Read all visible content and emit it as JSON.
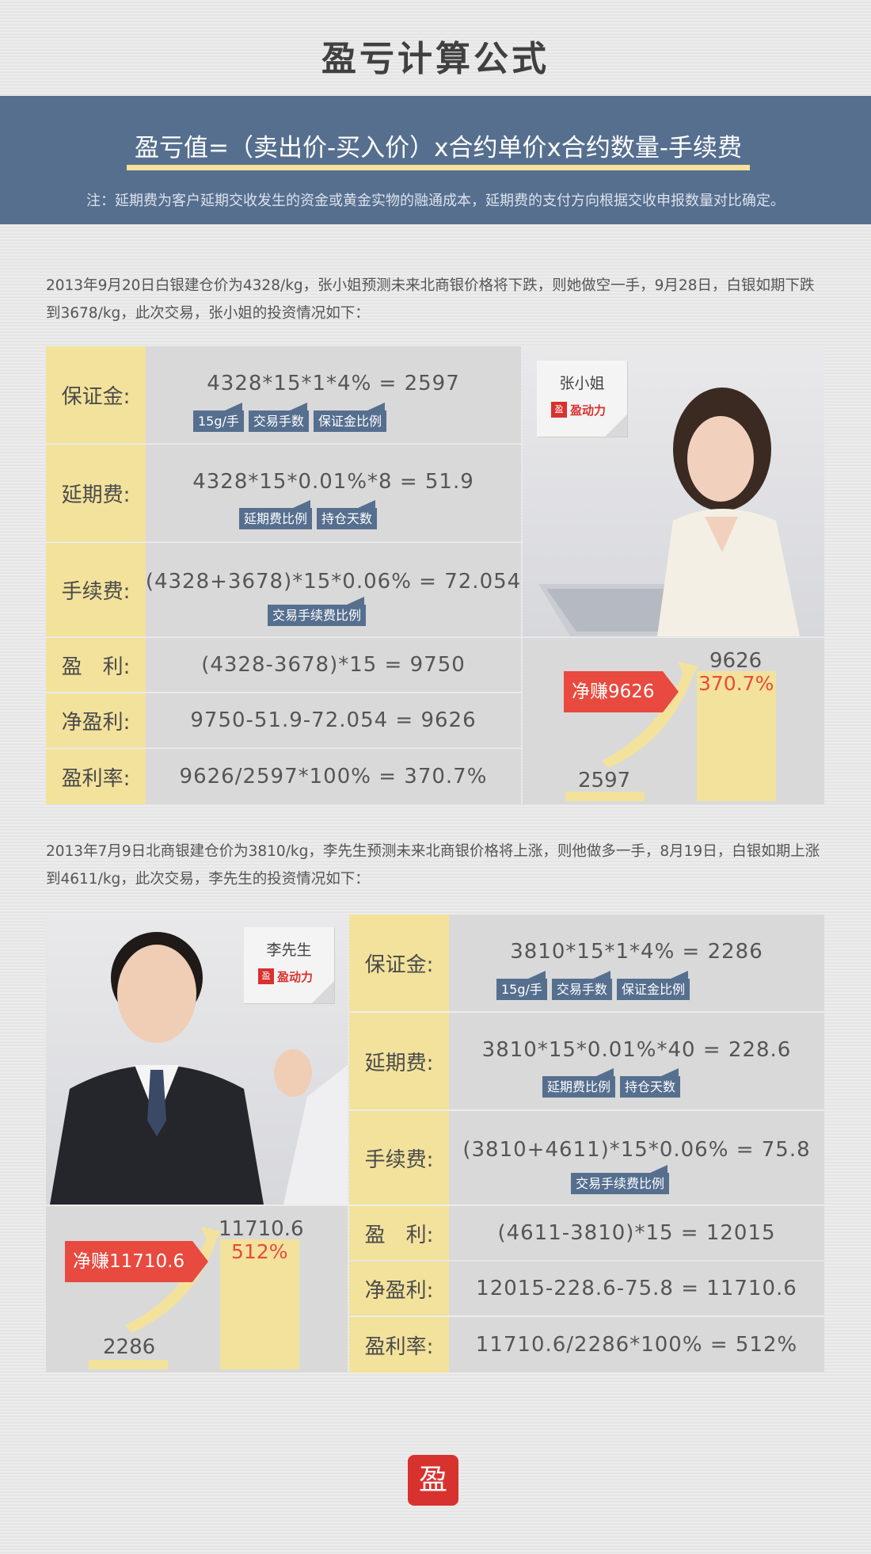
{
  "title": "盈亏计算公式",
  "banner": {
    "formula": "盈亏值=（卖出价-买入价）x合约单价x合约数量-手续费",
    "note": "注：延期费为客户延期交收发生的资金或黄金实物的融通成本，延期费的支付方向根据交收申报数量对比确定。"
  },
  "case1": {
    "intro": "2013年9月20日白银建仓价为4328/kg，张小姐预测未来北商银价格将下跌，则她做空一手，9月28日，白银如期下跌到3678/kg，此次交易，张小姐的投资情况如下：",
    "rows": [
      {
        "label": "保证金:",
        "value": "4328*15*1*4% = 2597",
        "tags": [
          "15g/手",
          "交易手数",
          "保证金比例"
        ]
      },
      {
        "label": "延期费:",
        "value": "4328*15*0.01%*8 = 51.9",
        "tags": [
          "延期费比例",
          "持仓天数"
        ]
      },
      {
        "label": "手续费:",
        "value": "(4328+3678)*15*0.06% = 72.054",
        "tags": [
          "交易手续费比例"
        ]
      },
      {
        "label": "盈　利:",
        "value": "(4328-3678)*15 = 9750"
      },
      {
        "label": "净盈利:",
        "value": "9750-51.9-72.054 = 9626"
      },
      {
        "label": "盈利率:",
        "value": "9626/2597*100% = 370.7%"
      }
    ],
    "person": "张小姐",
    "logo_text": "盈动力",
    "chart": {
      "base": "2597",
      "top": "9626",
      "pct": "370.7%",
      "badge": "净赚9626"
    }
  },
  "case2": {
    "intro": "2013年7月9日北商银建仓价为3810/kg，李先生预测未来北商银价格将上涨，则他做多一手，8月19日，白银如期上涨到4611/kg，此次交易，李先生的投资情况如下：",
    "rows": [
      {
        "label": "保证金:",
        "value": "3810*15*1*4% = 2286",
        "tags": [
          "15g/手",
          "交易手数",
          "保证金比例"
        ]
      },
      {
        "label": "延期费:",
        "value": "3810*15*0.01%*40 = 228.6",
        "tags": [
          "延期费比例",
          "持仓天数"
        ]
      },
      {
        "label": "手续费:",
        "value": "(3810+4611)*15*0.06% = 75.8",
        "tags": [
          "交易手续费比例"
        ]
      },
      {
        "label": "盈　利:",
        "value": "(4611-3810)*15 = 12015"
      },
      {
        "label": "净盈利:",
        "value": "12015-228.6-75.8 = 11710.6"
      },
      {
        "label": "盈利率:",
        "value": "11710.6/2286*100% = 512%"
      }
    ],
    "person": "李先生",
    "logo_text": "盈动力",
    "chart": {
      "base": "2286",
      "top": "11710.6",
      "pct": "512%",
      "badge": "净赚11710.6"
    }
  },
  "colors": {
    "banner": "#566f8f",
    "highlight": "#f3e29c",
    "accent_red": "#e84a3f"
  }
}
